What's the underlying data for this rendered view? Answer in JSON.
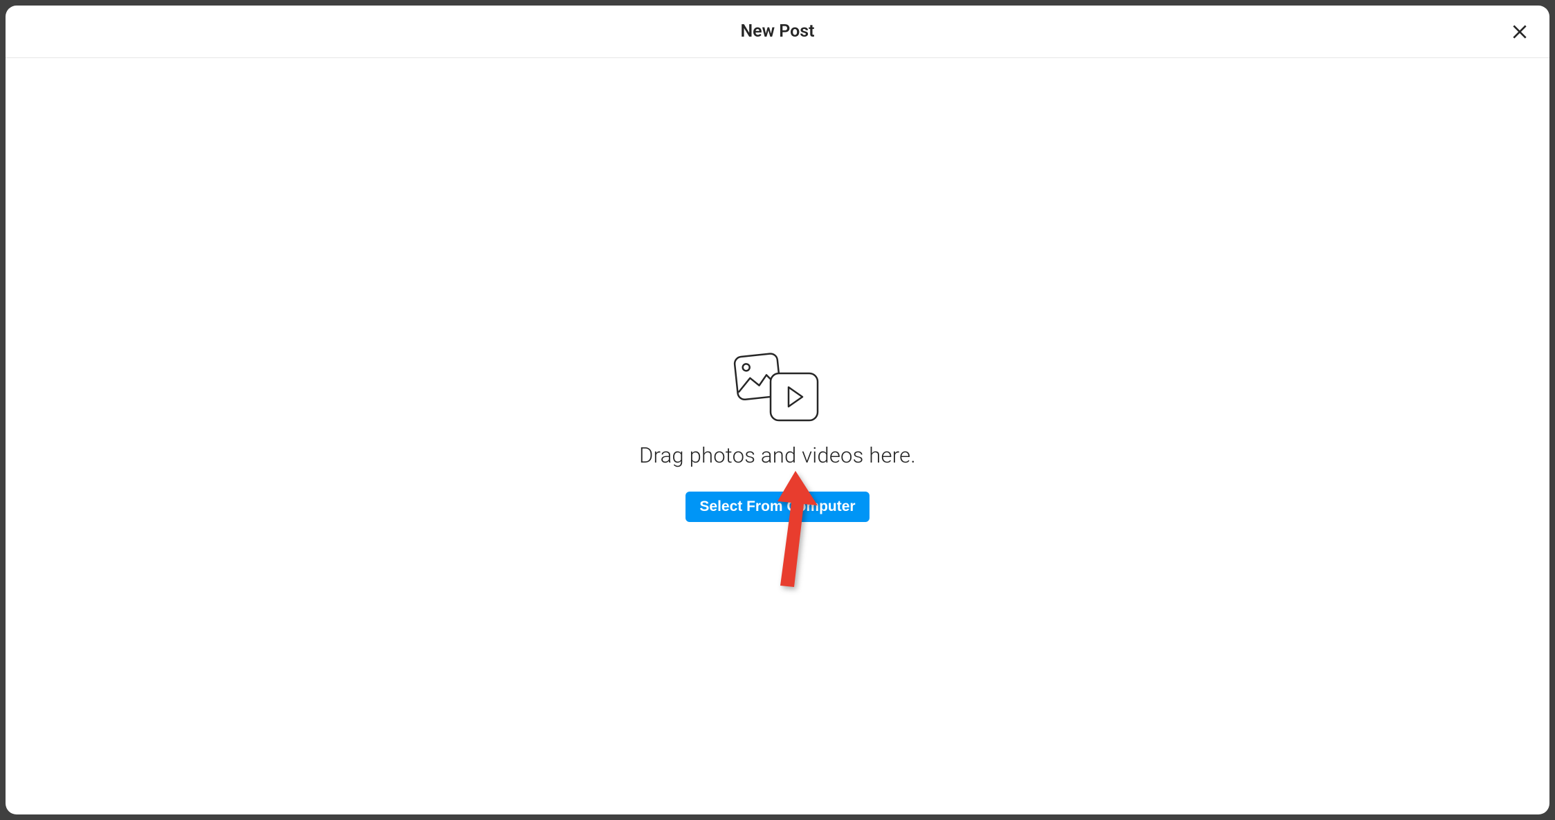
{
  "modal": {
    "title": "New Post",
    "drop_text": "Drag photos and videos here.",
    "select_button_label": "Select From Computer"
  },
  "colors": {
    "accent": "#0095f6",
    "text_primary": "#262626",
    "annotation": "#e83d2e"
  }
}
